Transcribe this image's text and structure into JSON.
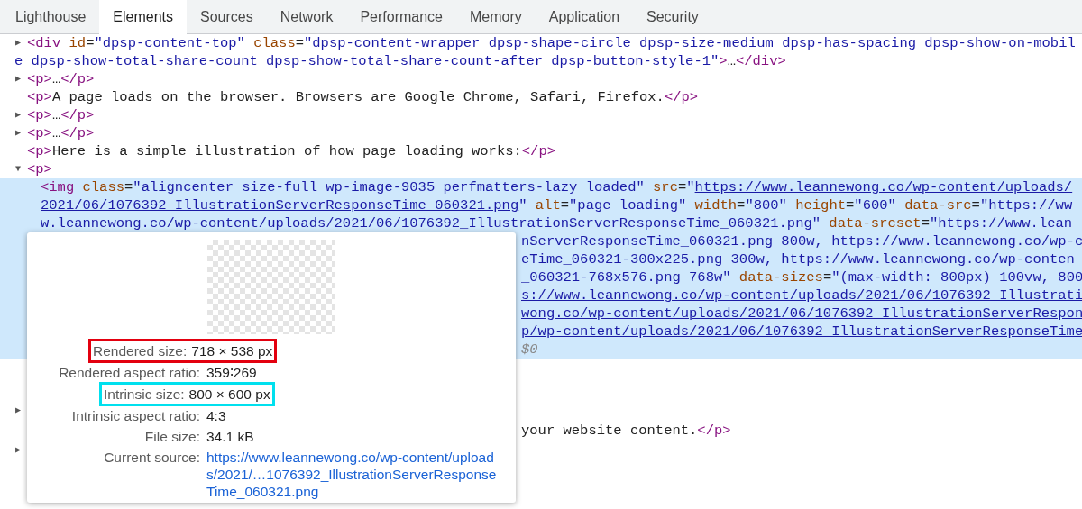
{
  "tabs": [
    {
      "label": "Lighthouse",
      "selected": false
    },
    {
      "label": "Elements",
      "selected": true
    },
    {
      "label": "Sources",
      "selected": false
    },
    {
      "label": "Network",
      "selected": false
    },
    {
      "label": "Performance",
      "selected": false
    },
    {
      "label": "Memory",
      "selected": false
    },
    {
      "label": "Application",
      "selected": false
    },
    {
      "label": "Security",
      "selected": false
    }
  ],
  "nodes": [
    {
      "arrow": "▶",
      "selected": false,
      "lines": [
        {
          "kind": "full",
          "segments": [
            {
              "kind": "tag",
              "s": "<div"
            },
            {
              "kind": "attr",
              "s": " id"
            },
            {
              "kind": "text",
              "s": "="
            },
            {
              "kind": "val",
              "s": "\"dpsp-content-top\""
            },
            {
              "kind": "attr",
              "s": " class"
            },
            {
              "kind": "text",
              "s": "="
            },
            {
              "kind": "val",
              "s": "\"dpsp-content-wrapper dpsp-shape-circle dpsp-size-medium dpsp-has-spacing dpsp-show-on-mobil"
            }
          ]
        },
        {
          "kind": "full",
          "segments": [
            {
              "kind": "val",
              "s": "e dpsp-show-total-share-count dpsp-show-total-share-count-after dpsp-button-style-1\""
            },
            {
              "kind": "tag",
              "s": ">"
            },
            {
              "kind": "text",
              "s": "…"
            },
            {
              "kind": "tag",
              "s": "</div>"
            }
          ]
        }
      ]
    },
    {
      "arrow": "▶",
      "selected": false,
      "lines": [
        {
          "kind": "full",
          "segments": [
            {
              "kind": "tag",
              "s": "<p>"
            },
            {
              "kind": "text",
              "s": "…"
            },
            {
              "kind": "tag",
              "s": "</p>"
            }
          ]
        }
      ]
    },
    {
      "selected": false,
      "lines": [
        {
          "kind": "full",
          "segments": [
            {
              "kind": "tag",
              "s": "<p>"
            },
            {
              "kind": "text",
              "s": "A page loads on the browser. Browsers are Google Chrome, Safari, Firefox."
            },
            {
              "kind": "tag",
              "s": "</p>"
            }
          ]
        }
      ]
    },
    {
      "arrow": "▶",
      "selected": false,
      "lines": [
        {
          "kind": "full",
          "segments": [
            {
              "kind": "tag",
              "s": "<p>"
            },
            {
              "kind": "text",
              "s": "…"
            },
            {
              "kind": "tag",
              "s": "</p>"
            }
          ]
        }
      ]
    },
    {
      "arrow": "▶",
      "selected": false,
      "lines": [
        {
          "kind": "full",
          "segments": [
            {
              "kind": "tag",
              "s": "<p>"
            },
            {
              "kind": "text",
              "s": "…"
            },
            {
              "kind": "tag",
              "s": "</p>"
            }
          ]
        }
      ]
    },
    {
      "selected": false,
      "lines": [
        {
          "kind": "full",
          "segments": [
            {
              "kind": "tag",
              "s": "<p>"
            },
            {
              "kind": "text",
              "s": "Here is a simple illustration of how page loading works:"
            },
            {
              "kind": "tag",
              "s": "</p>"
            }
          ]
        }
      ]
    },
    {
      "arrow": "▼",
      "selected": false,
      "lines": [
        {
          "kind": "full",
          "segments": [
            {
              "kind": "tag",
              "s": "<p>"
            }
          ]
        }
      ],
      "children": [
        {
          "selected": true,
          "lines": [
            {
              "kind": "full",
              "segments": [
                {
                  "kind": "tag",
                  "s": "<img"
                },
                {
                  "kind": "attr",
                  "s": " class"
                },
                {
                  "kind": "text",
                  "s": "="
                },
                {
                  "kind": "val",
                  "s": "\"aligncenter size-full wp-image-9035 perfmatters-lazy loaded\""
                },
                {
                  "kind": "attr",
                  "s": " src"
                },
                {
                  "kind": "text",
                  "s": "="
                },
                {
                  "kind": "val",
                  "s": "\""
                },
                {
                  "kind": "link",
                  "s": "https://www.leannewong.co/wp-content/uploads/"
                }
              ]
            },
            {
              "kind": "full",
              "segments": [
                {
                  "kind": "link",
                  "s": "2021/06/1076392_IllustrationServerResponseTime_060321.png"
                },
                {
                  "kind": "val",
                  "s": "\""
                },
                {
                  "kind": "attr",
                  "s": " alt"
                },
                {
                  "kind": "text",
                  "s": "="
                },
                {
                  "kind": "val",
                  "s": "\"page loading\""
                },
                {
                  "kind": "attr",
                  "s": " width"
                },
                {
                  "kind": "text",
                  "s": "="
                },
                {
                  "kind": "val",
                  "s": "\"800\""
                },
                {
                  "kind": "attr",
                  "s": " height"
                },
                {
                  "kind": "text",
                  "s": "="
                },
                {
                  "kind": "val",
                  "s": "\"600\""
                },
                {
                  "kind": "attr",
                  "s": " data-src"
                },
                {
                  "kind": "text",
                  "s": "="
                },
                {
                  "kind": "val",
                  "s": "\"https://ww"
                }
              ]
            },
            {
              "kind": "full",
              "segments": [
                {
                  "kind": "val",
                  "s": "w.leannewong.co/wp-content/uploads/2021/06/1076392_IllustrationServerResponseTime_060321.png\""
                },
                {
                  "kind": "attr",
                  "s": " data-srcset"
                },
                {
                  "kind": "text",
                  "s": "="
                },
                {
                  "kind": "val",
                  "s": "\"https://www.lean"
                }
              ]
            },
            {
              "kind": "fragment",
              "segments": [
                {
                  "kind": "val",
                  "s": "nServerResponseTime_060321.png 800w, https://www.leannewong.co/wp-c"
                }
              ]
            },
            {
              "kind": "fragment",
              "segments": [
                {
                  "kind": "val",
                  "s": "eTime_060321-300x225.png 300w, https://www.leannewong.co/wp-conten"
                }
              ]
            },
            {
              "kind": "fragment",
              "segments": [
                {
                  "kind": "val",
                  "s": "_060321-768x576.png 768w\""
                },
                {
                  "kind": "attr",
                  "s": " data-sizes"
                },
                {
                  "kind": "text",
                  "s": "="
                },
                {
                  "kind": "val",
                  "s": "\"(max-width: 800px) 100vw, 800"
                }
              ]
            },
            {
              "kind": "fragment",
              "segments": [
                {
                  "kind": "link",
                  "s": "s://www.leannewong.co/wp-content/uploads/2021/06/1076392_Illustrati"
                }
              ]
            },
            {
              "kind": "fragment",
              "segments": [
                {
                  "kind": "link",
                  "s": "wong.co/wp-content/uploads/2021/06/1076392_IllustrationServerRespon"
                }
              ]
            },
            {
              "kind": "fragment",
              "segments": [
                {
                  "kind": "link",
                  "s": "p/wp-content/uploads/2021/06/1076392_IllustrationServerResponseTime"
                }
              ]
            },
            {
              "kind": "fragment",
              "segments": [
                {
                  "kind": "dim",
                  "s": "$0"
                }
              ]
            }
          ]
        }
      ]
    }
  ],
  "tail": [
    {
      "arrow": "▶"
    },
    {
      "segments": [
        {
          "kind": "text",
          "s": "your website content."
        },
        {
          "kind": "tag",
          "s": "</p>"
        }
      ]
    },
    {
      "arrow": "▶"
    }
  ],
  "tooltip": {
    "rows": [
      {
        "label": "Rendered size:",
        "value": "718 × 538 px",
        "kind": "plain",
        "color": "#e3000f"
      },
      {
        "label": "Rendered aspect ratio:",
        "value": "359∶269",
        "kind": "plain"
      },
      {
        "label": "Intrinsic size:",
        "value": "800 × 600 px",
        "kind": "plain",
        "color": "#00e0ee"
      },
      {
        "label": "Intrinsic aspect ratio:",
        "value": "4:3",
        "kind": "plain"
      },
      {
        "label": "File size:",
        "value": "34.1 kB",
        "kind": "plain"
      },
      {
        "label": "Current source:",
        "value": "https://www.leannewong.co/wp-content/uploads/2021/…1076392_IllustrationServerResponseTime_060321.png",
        "kind": "link"
      }
    ]
  }
}
